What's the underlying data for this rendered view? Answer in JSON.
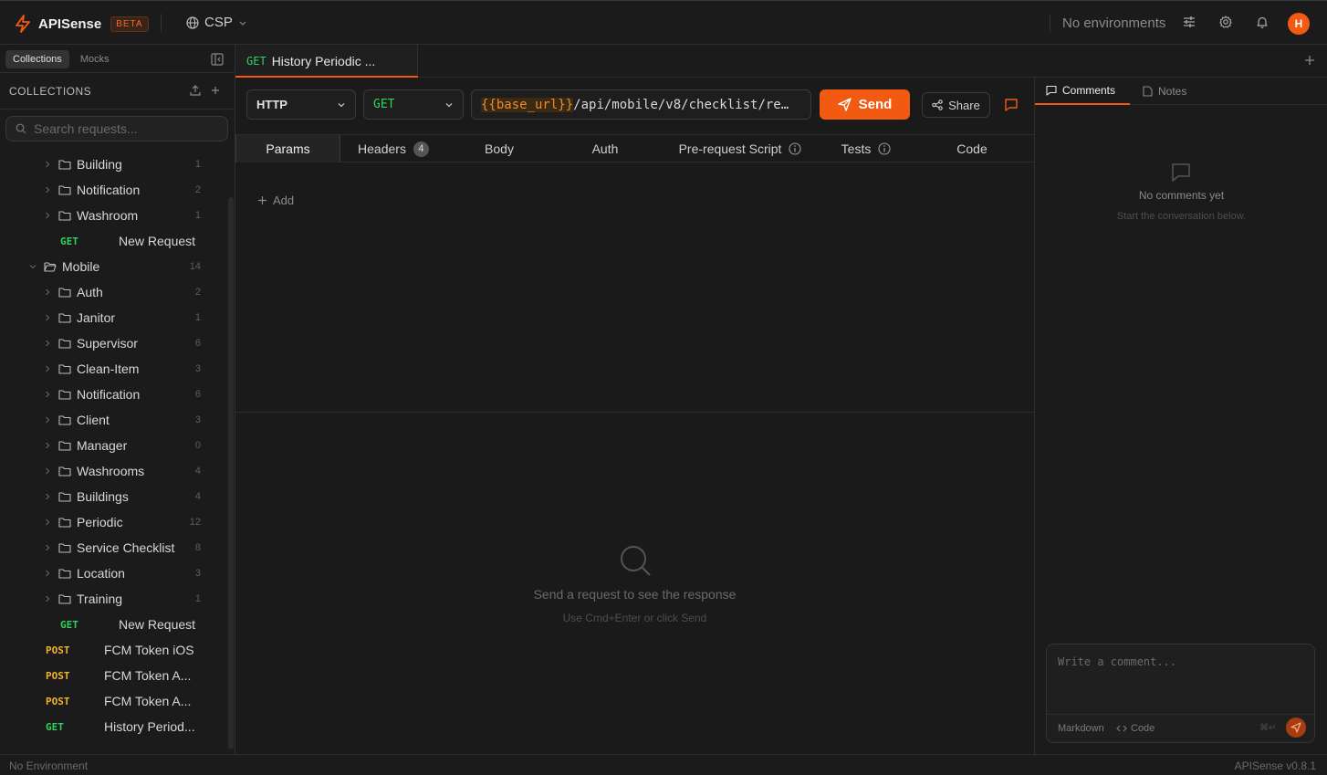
{
  "app": {
    "name": "APISense",
    "beta": "BETA",
    "workspace": "CSP",
    "environment": "No environments",
    "avatar": "H",
    "accent": "#f25a12"
  },
  "sidebar": {
    "tabs": [
      "Collections",
      "Mocks"
    ],
    "section_title": "COLLECTIONS",
    "search_placeholder": "Search requests...",
    "tree": [
      {
        "kind": "folder",
        "name": "Building",
        "count": "1",
        "depth": 1
      },
      {
        "kind": "folder",
        "name": "Notification",
        "count": "2",
        "depth": 1
      },
      {
        "kind": "folder",
        "name": "Washroom",
        "count": "1",
        "depth": 1
      },
      {
        "kind": "request",
        "method": "GET",
        "name": "New Request",
        "depth": 1
      },
      {
        "kind": "folder-open",
        "name": "Mobile",
        "count": "14",
        "depth": 0
      },
      {
        "kind": "folder",
        "name": "Auth",
        "count": "2",
        "depth": 1
      },
      {
        "kind": "folder",
        "name": "Janitor",
        "count": "1",
        "depth": 1
      },
      {
        "kind": "folder",
        "name": "Supervisor",
        "count": "6",
        "depth": 1
      },
      {
        "kind": "folder",
        "name": "Clean-Item",
        "count": "3",
        "depth": 1
      },
      {
        "kind": "folder",
        "name": "Notification",
        "count": "6",
        "depth": 1
      },
      {
        "kind": "folder",
        "name": "Client",
        "count": "3",
        "depth": 1
      },
      {
        "kind": "folder",
        "name": "Manager",
        "count": "0",
        "depth": 1
      },
      {
        "kind": "folder",
        "name": "Washrooms",
        "count": "4",
        "depth": 1
      },
      {
        "kind": "folder",
        "name": "Buildings",
        "count": "4",
        "depth": 1
      },
      {
        "kind": "folder",
        "name": "Periodic",
        "count": "12",
        "depth": 1
      },
      {
        "kind": "folder",
        "name": "Service Checklist",
        "count": "8",
        "depth": 1
      },
      {
        "kind": "folder",
        "name": "Location",
        "count": "3",
        "depth": 1
      },
      {
        "kind": "folder",
        "name": "Training",
        "count": "1",
        "depth": 1
      },
      {
        "kind": "request",
        "method": "GET",
        "name": "New Request",
        "depth": 1
      },
      {
        "kind": "request",
        "method": "POST",
        "name": "FCM Token iOS",
        "depth": 0
      },
      {
        "kind": "request",
        "method": "POST",
        "name": "FCM Token A...",
        "depth": 0
      },
      {
        "kind": "request",
        "method": "POST",
        "name": "FCM Token A...",
        "depth": 0
      },
      {
        "kind": "request",
        "method": "GET",
        "name": "History Period...",
        "depth": 0
      }
    ]
  },
  "tab": {
    "method": "GET",
    "name": "History Periodic ..."
  },
  "request": {
    "protocol": "HTTP",
    "method": "GET",
    "url_var": "{{base_url}}",
    "url_path": "/api/mobile/v8/checklist/re…",
    "send": "Send",
    "share": "Share"
  },
  "subtabs": {
    "params": "Params",
    "headers": "Headers",
    "headers_count": "4",
    "body": "Body",
    "auth": "Auth",
    "prerequest": "Pre-request Script",
    "tests": "Tests",
    "code": "Code"
  },
  "params": {
    "add": "Add"
  },
  "response": {
    "message": "Send a request to see the response",
    "hint": "Use Cmd+Enter or click Send"
  },
  "comments": {
    "tab_comments": "Comments",
    "tab_notes": "Notes",
    "empty_title": "No comments yet",
    "empty_sub": "Start the conversation below.",
    "placeholder": "Write a comment...",
    "markdown": "Markdown",
    "code": "Code",
    "shortcut": "⌘↵"
  },
  "status": {
    "env": "No Environment",
    "version": "APISense v0.8.1"
  }
}
